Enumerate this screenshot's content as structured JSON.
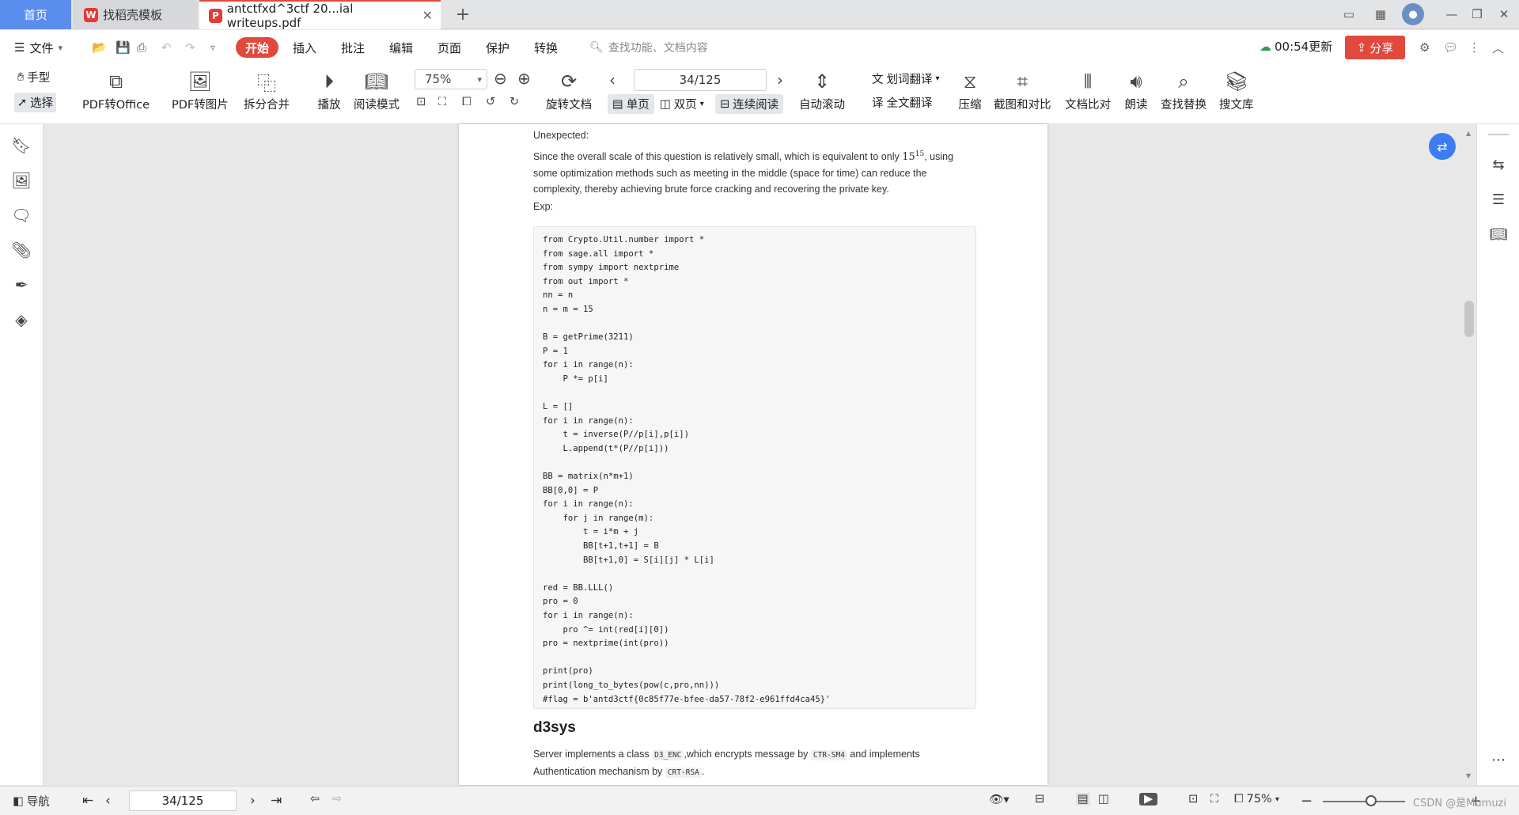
{
  "tabs": {
    "home": "首页",
    "templates": "找稻壳模板",
    "document": "antctfxd^3ctf 20...ial writeups.pdf"
  },
  "menu": {
    "file": "文件",
    "start": "开始",
    "insert": "插入",
    "annotate": "批注",
    "edit": "编辑",
    "page": "页面",
    "protect": "保护",
    "convert": "转换",
    "search_placeholder": "查找功能、文档内容",
    "sync_status": "00:54更新",
    "share": "分享"
  },
  "toolbar": {
    "hand": "手型",
    "select": "选择",
    "pdf_to_office": "PDF转Office",
    "pdf_to_image": "PDF转图片",
    "split_merge": "拆分合并",
    "play": "播放",
    "read_mode": "阅读模式",
    "zoom": "75%",
    "page_indicator": "34/125",
    "rotate_doc": "旋转文档",
    "single_page": "单页",
    "double_page": "双页",
    "continuous": "连续阅读",
    "auto_scroll": "自动滚动",
    "word_translate": "划词翻译",
    "full_translate": "全文翻译",
    "compress": "压缩",
    "screenshot_compare": "截图和对比",
    "doc_compare": "文档比对",
    "read_aloud": "朗读",
    "find_replace": "查找替换",
    "search_library": "搜文库"
  },
  "document": {
    "unexpected": "Unexpected:",
    "para1_a": "Since the overall scale of this question is relatively small, which is equivalent to only ",
    "para1_base": "15",
    "para1_exp": "15",
    "para1_b": ", using some optimization methods such as meeting in the middle (space for time) can reduce the complexity, thereby achieving brute force cracking and recovering the private key.",
    "exp_label": "Exp:",
    "code": "from Crypto.Util.number import *\nfrom sage.all import *\nfrom sympy import nextprime\nfrom out import *\nnn = n\nn = m = 15\n\nB = getPrime(3211)\nP = 1\nfor i in range(n):\n    P *= p[i]\n\nL = []\nfor i in range(n):\n    t = inverse(P//p[i],p[i])\n    L.append(t*(P//p[i]))\n\nBB = matrix(n*m+1)\nBB[0,0] = P\nfor i in range(n):\n    for j in range(m):\n        t = i*m + j\n        BB[t+1,t+1] = B\n        BB[t+1,0] = S[i][j] * L[i]\n\nred = BB.LLL()\npro = 0\nfor i in range(n):\n    pro ^= int(red[i][0])\npro = nextprime(int(pro))\n\nprint(pro)\nprint(long_to_bytes(pow(c,pro,nn)))\n#flag = b'antd3ctf{0c85f77e-bfee-da57-78f2-e961ffd4ca45}'",
    "heading": "d3sys",
    "para2_a": "Server implements a class ",
    "para2_code1": "D3_ENC",
    "para2_b": ",which encrypts message by ",
    "para2_code2": "CTR-SM4",
    "para2_c": " and implements Authentication mechanism by ",
    "para2_code3": "CRT-RSA",
    "para2_d": "."
  },
  "statusbar": {
    "nav": "导航",
    "page": "34/125",
    "zoom": "75%",
    "watermark": "CSDN @是Mumuzi"
  },
  "colors": {
    "accent_red": "#e0493b",
    "tab_blue": "#5b8def",
    "float_blue": "#3d7cf0"
  }
}
